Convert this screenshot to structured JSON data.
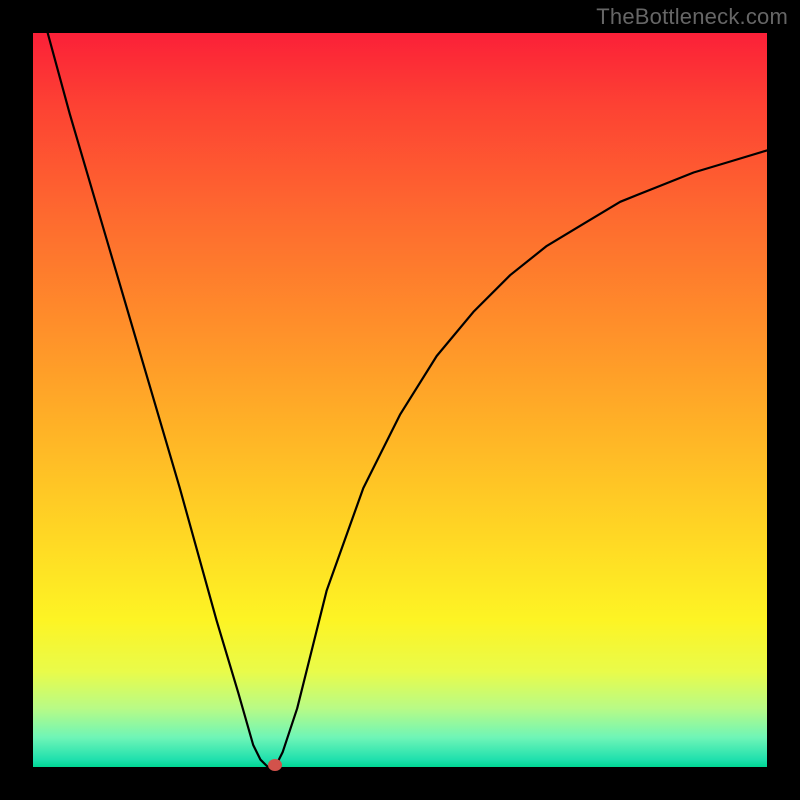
{
  "watermark": "TheBottleneck.com",
  "chart_data": {
    "type": "line",
    "title": "",
    "xlabel": "",
    "ylabel": "",
    "xlim": [
      0,
      100
    ],
    "ylim": [
      0,
      100
    ],
    "series": [
      {
        "name": "curve",
        "x": [
          2,
          5,
          10,
          15,
          20,
          25,
          28,
          30,
          31,
          32,
          33,
          34,
          36,
          38,
          40,
          45,
          50,
          55,
          60,
          65,
          70,
          75,
          80,
          85,
          90,
          95,
          100
        ],
        "values": [
          100,
          89,
          72,
          55,
          38,
          20,
          10,
          3,
          1,
          0,
          0,
          2,
          8,
          16,
          24,
          38,
          48,
          56,
          62,
          67,
          71,
          74,
          77,
          79,
          81,
          82.5,
          84
        ]
      }
    ],
    "marker": {
      "x": 33,
      "y": 0,
      "color": "#d2524b"
    },
    "gradient_stops": [
      {
        "pos": 0,
        "color": "#fb2038"
      },
      {
        "pos": 10,
        "color": "#fd4233"
      },
      {
        "pos": 25,
        "color": "#fe6a2f"
      },
      {
        "pos": 40,
        "color": "#ff8f2a"
      },
      {
        "pos": 55,
        "color": "#ffb526"
      },
      {
        "pos": 70,
        "color": "#ffdb24"
      },
      {
        "pos": 80,
        "color": "#fdf424"
      },
      {
        "pos": 87,
        "color": "#e9fb4a"
      },
      {
        "pos": 92,
        "color": "#b8fb86"
      },
      {
        "pos": 96,
        "color": "#6ef5b7"
      },
      {
        "pos": 99,
        "color": "#1fe0ad"
      },
      {
        "pos": 100,
        "color": "#00d693"
      }
    ]
  }
}
